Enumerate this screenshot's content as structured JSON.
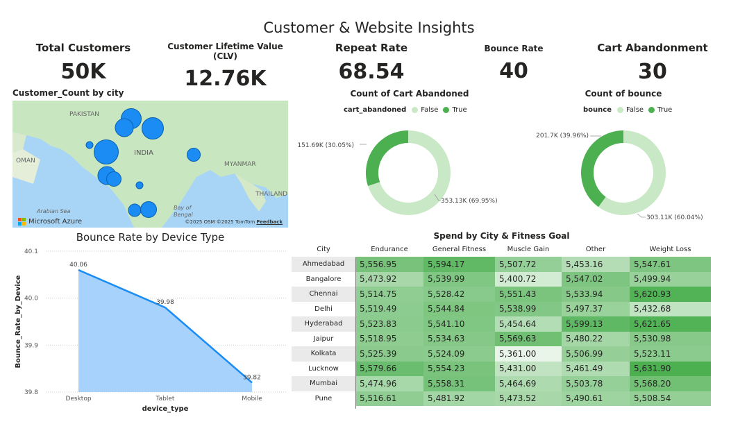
{
  "page_title": "Customer & Website Insights",
  "kpis": [
    {
      "label": "Total Customers",
      "value": "50K"
    },
    {
      "label": "Customer Lifetime Value (CLV)",
      "value": "12.76K"
    },
    {
      "label": "Repeat Rate",
      "value": "68.54"
    },
    {
      "label": "Bounce Rate",
      "value": "40"
    },
    {
      "label": "Cart Abandonment",
      "value": "30"
    }
  ],
  "map": {
    "title": "Customer_Count by city",
    "labels": {
      "pakistan": "PAKISTAN",
      "india": "INDIA",
      "oman": "OMAN",
      "myanmar": "MYANMAR",
      "thailand": "THAILAND",
      "arabian_sea": "Arabian Sea",
      "bay": "Bay of",
      "bengal": "Bengal"
    },
    "attribution": "©2025 OSM ©2025 TomTom",
    "feedback": "Feedback",
    "brand": "Microsoft Azure",
    "bubble_color": "#1a8cf3"
  },
  "colors": {
    "light_green": "#c9e9c6",
    "dark_green": "#4caf50",
    "area_fill": "#a6d2fb",
    "line_blue": "#1a8cf3"
  },
  "chart_data": [
    {
      "type": "pie",
      "title": "Count of Cart Abandoned",
      "legend_title": "cart_abandoned",
      "categories": [
        "False",
        "True"
      ],
      "values": [
        353130,
        151690
      ],
      "labels": [
        "353.13K (69.95%)",
        "151.69K (30.05%)"
      ],
      "colors": [
        "#c9e9c6",
        "#4caf50"
      ]
    },
    {
      "type": "pie",
      "title": "Count of bounce",
      "legend_title": "bounce",
      "categories": [
        "False",
        "True"
      ],
      "values": [
        303110,
        201700
      ],
      "labels": [
        "303.11K (60.04%)",
        "201.7K (39.96%)"
      ],
      "colors": [
        "#c9e9c6",
        "#4caf50"
      ]
    },
    {
      "type": "area",
      "title": "Bounce Rate by Device Type",
      "xlabel": "device_type",
      "ylabel": "Bounce_Rate_by_Device",
      "categories": [
        "Desktop",
        "Tablet",
        "Mobile"
      ],
      "values": [
        40.06,
        39.98,
        39.82
      ],
      "data_labels": [
        "40.06",
        "39.98",
        "39.82"
      ],
      "ylim": [
        39.8,
        40.1
      ],
      "yticks": [
        39.8,
        39.9,
        40.0,
        40.1
      ],
      "ytick_labels": [
        "39.8",
        "39.9",
        "40.0",
        "40.1"
      ],
      "grid": true
    },
    {
      "type": "table",
      "title": "Spend by City & Fitness Goal",
      "row_header": "City",
      "columns": [
        "Endurance",
        "General Fitness",
        "Muscle Gain",
        "Other",
        "Weight Loss"
      ],
      "rows": [
        {
          "city": "Ahmedabad",
          "values": [
            "5,556.95",
            "5,594.17",
            "5,507.72",
            "5,453.16",
            "5,547.61"
          ]
        },
        {
          "city": "Bangalore",
          "values": [
            "5,473.92",
            "5,539.99",
            "5,400.72",
            "5,547.02",
            "5,499.94"
          ]
        },
        {
          "city": "Chennai",
          "values": [
            "5,514.75",
            "5,528.42",
            "5,551.43",
            "5,533.94",
            "5,620.93"
          ]
        },
        {
          "city": "Delhi",
          "values": [
            "5,519.49",
            "5,544.84",
            "5,538.99",
            "5,497.37",
            "5,432.68"
          ]
        },
        {
          "city": "Hyderabad",
          "values": [
            "5,523.83",
            "5,541.10",
            "5,454.64",
            "5,599.13",
            "5,621.65"
          ]
        },
        {
          "city": "Jaipur",
          "values": [
            "5,518.95",
            "5,534.63",
            "5,569.63",
            "5,480.22",
            "5,530.98"
          ]
        },
        {
          "city": "Kolkata",
          "values": [
            "5,525.39",
            "5,524.09",
            "5,361.00",
            "5,506.99",
            "5,523.11"
          ]
        },
        {
          "city": "Lucknow",
          "values": [
            "5,579.66",
            "5,554.23",
            "5,431.00",
            "5,461.49",
            "5,631.90"
          ]
        },
        {
          "city": "Mumbai",
          "values": [
            "5,474.96",
            "5,558.31",
            "5,464.69",
            "5,503.78",
            "5,568.20"
          ]
        },
        {
          "city": "Pune",
          "values": [
            "5,516.61",
            "5,481.92",
            "5,473.52",
            "5,490.61",
            "5,508.54"
          ]
        }
      ]
    }
  ]
}
